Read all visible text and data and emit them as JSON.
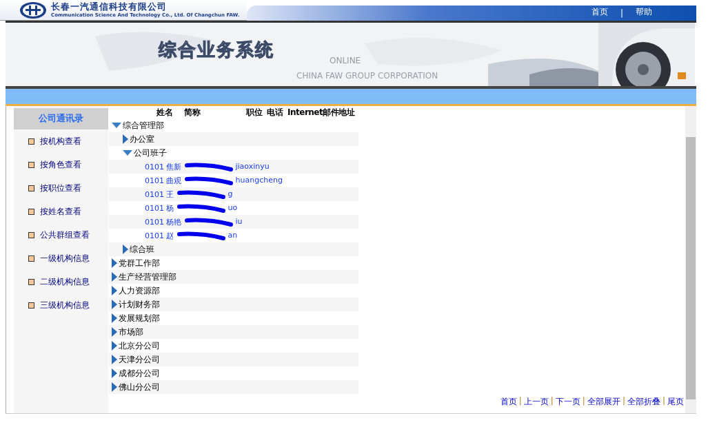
{
  "header": {
    "company_name": "长春一汽通信科技有限公司",
    "company_subtitle": "Communication Science And Technology Co., Ltd. Of Changchun FAW.",
    "links": [
      "首页",
      "帮助"
    ],
    "separator": "|"
  },
  "banner": {
    "title": "综合业务系统",
    "tagline": "ONLINE",
    "subline": "CHINA FAW GROUP CORPORATION"
  },
  "sidebar": {
    "title": "公司通讯录",
    "items": [
      "按机构查看",
      "按角色查看",
      "按职位查看",
      "按姓名查看",
      "公共群组查看",
      "一级机构信息",
      "二级机构信息",
      "三级机构信息"
    ]
  },
  "table": {
    "columns": [
      "姓名",
      "简称",
      "职位",
      "电话",
      "Internet邮件地址"
    ]
  },
  "tree": [
    {
      "label": "综合管理部",
      "expanded": true,
      "children": [
        {
          "label": "办公室",
          "expanded": false
        },
        {
          "label": "公司班子",
          "expanded": true,
          "people": [
            {
              "code": "0101",
              "name": "焦新",
              "tail": "jiaoxinyu"
            },
            {
              "code": "0101",
              "name": "曲观",
              "tail": "huangcheng"
            },
            {
              "code": "0101",
              "name": "王",
              "tail": "g"
            },
            {
              "code": "0101",
              "name": "杨",
              "tail": "uo"
            },
            {
              "code": "0101",
              "name": "杨艳",
              "tail": "iu"
            },
            {
              "code": "0101",
              "name": "赵",
              "tail": "an"
            }
          ]
        },
        {
          "label": "综合班",
          "expanded": false
        }
      ]
    },
    {
      "label": "党群工作部",
      "expanded": false
    },
    {
      "label": "生产经营管理部",
      "expanded": false
    },
    {
      "label": "人力资源部",
      "expanded": false
    },
    {
      "label": "计划财务部",
      "expanded": false
    },
    {
      "label": "发展规划部",
      "expanded": false
    },
    {
      "label": "市场部",
      "expanded": false
    },
    {
      "label": "北京分公司",
      "expanded": false
    },
    {
      "label": "天津分公司",
      "expanded": false
    },
    {
      "label": "成都分公司",
      "expanded": false
    },
    {
      "label": "佛山分公司",
      "expanded": false
    }
  ],
  "pager": [
    "首页",
    "上一页",
    "下一页",
    "全部展开",
    "全部折叠",
    "尾页"
  ],
  "pager_separator": "|"
}
